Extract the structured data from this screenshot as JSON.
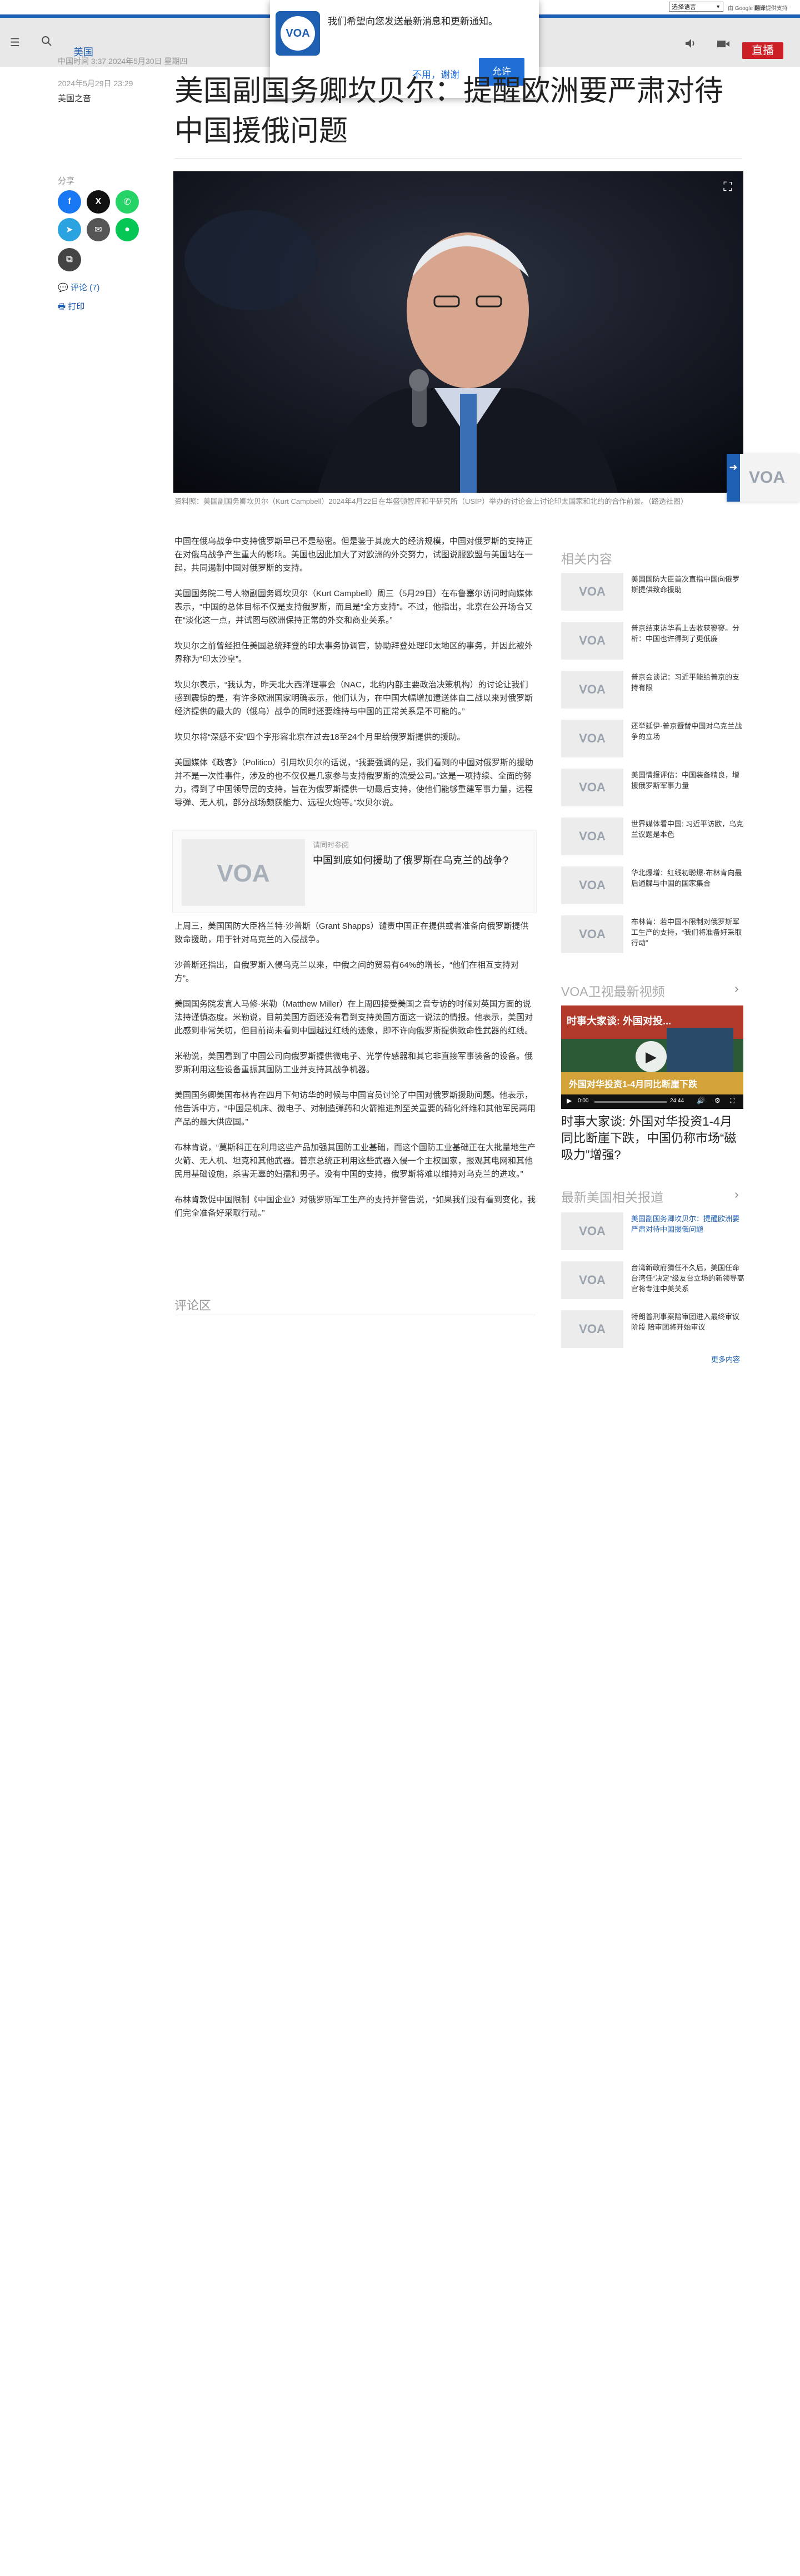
{
  "topbar": {
    "language_select": "选择语言",
    "powered_by_prefix": "由 Google",
    "powered_by_brand": "翻译",
    "powered_by_suffix": "提供支持"
  },
  "nav": {
    "menu_icon": "menu-icon",
    "search_icon": "search-icon",
    "section": "美国",
    "volume_icon": "volume-icon",
    "video_icon": "video-camera-icon",
    "live_label": "直播"
  },
  "notification": {
    "logo": "VOA",
    "message": "我们希望向您发送最新消息和更新通知。",
    "decline": "不用，谢谢",
    "accept": "允许"
  },
  "article_meta": {
    "top_date": "中国时间 3:37 2024年5月30日 星期四",
    "date": "2024年5月29日 23:29",
    "author": "美国之音"
  },
  "headline": "美国副国务卿坎贝尔：提醒欧洲要严肃对待中国援俄问题",
  "share": {
    "label": "分享",
    "comments": "评论 (7)",
    "print": "打印"
  },
  "caption": "资料照：美国副国务卿坎贝尔（Kurt Campbell）2024年4月22日在华盛顿智库和平研究所（USIP）举办的讨论会上讨论印太国家和北约的合作前景。（路透社图）",
  "paragraphs": [
    "中国在俄乌战争中支持俄罗斯早已不是秘密。但是鉴于其庞大的经济规模，中国对俄罗斯的支持正在对俄乌战争产生重大的影响。美国也因此加大了对欧洲的外交努力，试图说服欧盟与美国站在一起，共同遏制中国对俄罗斯的支持。",
    "美国国务院二号人物副国务卿坎贝尔（Kurt Campbell）周三（5月29日）在布鲁塞尔访问时向媒体表示，“中国的总体目标不仅是支持俄罗斯，而且是“全方支持”。不过，他指出，北京在公开场合又在“淡化这一点，并试图与欧洲保持正常的外交和商业关系。”",
    "坎贝尔之前曾经担任美国总统拜登的印太事务协调官，协助拜登处理印太地区的事务，并因此被外界称为“印太沙皇”。",
    "坎贝尔表示，“我认为，昨天北大西洋理事会（NAC，北约内部主要政治决策机构）的讨论让我们感到震惊的是，有许多欧洲国家明确表示，他们认为，在中国大幅增加遗送体自二战以来对俄罗斯经济提供的最大的（俄乌）战争的同时还要维持与中国的正常关系是不可能的。”",
    "坎贝尔将“深感不安”四个字形容北京在过去18至24个月里给俄罗斯提供的援助。",
    "美国媒体《政客》（Politico）引用坎贝尔的话说，“我要强调的是，我们看到的中国对俄罗斯的援助并不是一次性事件，涉及的也不仅仅是几家参与支持俄罗斯的流受公司。”这是一项持续、全面的努力，得到了中国领导层的支持，旨在为俄罗斯提供一切最后支持，使他们能够重建军事力量，远程导弹、无人机，部分战场颇获能力、远程火炮等。”坎贝尔说。",
    "上周三，美国国防大臣格兰特·沙普斯（Grant Shapps）谴责中国正在提供或者准备向俄罗斯提供致命援助，用于针对乌克兰的入侵战争。",
    "沙普斯还指出，自俄罗斯入侵乌克兰以来，中俄之间的贸易有64%的增长，“他们在相互支持对方”。",
    "美国国务院发言人马修·米勒（Matthew Miller）在上周四接受美国之音专访的时候对英国方面的说法持谨慎态度。米勒说，目前美国方面还没有看到支持英国方面这一说法的情报。他表示，美国对此感到非常关切，但目前尚未看到中国越过红线的迹象，即不许向俄罗斯提供致命性武器的红线。",
    "米勒说，美国看到了中国公司向俄罗斯提供微电子、光学传感器和其它非直接军事装备的设备。俄罗斯利用这些设备重振其国防工业并支持其战争机器。",
    "美国国务卿美国布林肯在四月下旬访华的时候与中国官员讨论了中国对俄罗斯援助问题。他表示，他告诉中方，“中国是机床、微电子、对制造弹药和火箭推进剂至关重要的硝化纤维和其他军民两用产品的最大供应国。”",
    "布林肯说，“莫斯科正在利用这些产品加强其国防工业基础，而这个国防工业基础正在大批量地生产火箭、无人机、坦克和其他武器。普京总统正利用这些武器入侵一个主权国家，报观其电网和其他民用基础设施，杀害无辜的妇孺和男子。没有中国的支持，俄罗斯将难以维持对乌克兰的进攻。”",
    "布林肯敦促中国限制《中国企业》对俄罗斯军工生产的支持并警告说，“如果我们没有看到变化，我们完全准备好采取行动。”"
  ],
  "related_box": {
    "kicker": "请同时参阅",
    "title": "中国到底如何援助了俄罗斯在乌克兰的战争?"
  },
  "comments_heading": "评论区",
  "rail": {
    "related_title": "相关内容",
    "related_items": [
      "美国国防大臣首次直指中国向俄罗斯提供致命援助",
      "普京结束访华看上去收获寥寥。分析：中国也许得到了更低廉",
      "普京会谈记：习近平能给普京的支持有限",
      "还举延伊·普京暨替中国对乌克兰战争的立场",
      "美国情报评估：中国装备精良，增援俄罗斯军事力量",
      "世界媒体看中国: 习近平访欧，乌克兰议题是本色",
      "华北爆增：红线初聪爆·布林肯向最后通牒与中国的国家集合",
      "布林肯：若中国不限制对俄罗斯军工生产的支持，“我们将准备好采取行动”"
    ],
    "video_title_heading": "VOA卫视最新视频",
    "video_overlay_top": "时事大家谈: 外国对投...",
    "video_overlay_bottom": "外国对华投资1-4月同比断崖下跌",
    "video_time": "0:00",
    "video_duration": "24:44",
    "video_caption": "时事大家谈: 外国对华投资1-4月同比断崖下跌，中国仍称市场“磁吸力”增强?",
    "latest_title": "最新美国相关报道",
    "latest_items": [
      "美国副国务卿坎贝尔：提醒欧洲要严肃对待中国援俄问题",
      "台湾新政府猜任不久后，美国任命台湾任“决定”级友台立场的新领导高官将专注中美关系",
      "特朗普刑事案陪审团进入最终审议阶段 陪审团将开始审议"
    ],
    "more_label": "更多内容"
  },
  "corner_tab": {
    "arrow_icon": "arrow-right-icon",
    "brand": "VOA"
  },
  "colors": {
    "brand_blue": "#1f5fb2",
    "live_red": "#cc1f25",
    "allow_blue": "#1f6fd6"
  }
}
